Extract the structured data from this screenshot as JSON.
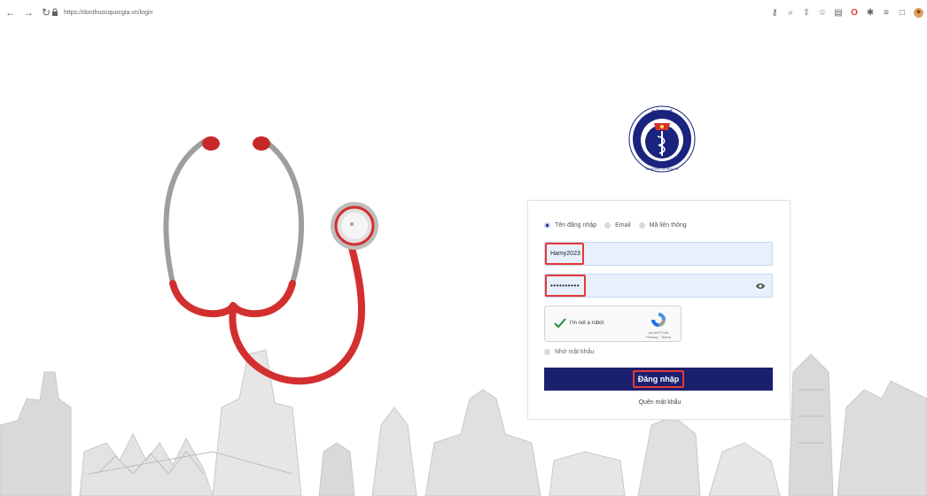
{
  "browser": {
    "url": "https://donthuocquocgia.vn/login"
  },
  "logo": {
    "top_text": "BỘ Y TẾ",
    "bottom_text": "MINISTRY OF HEALTH"
  },
  "login": {
    "radio_options": [
      "Tên đăng nhập",
      "Email",
      "Mã liên thông"
    ],
    "selected_index": 0,
    "username_value": "Hamy2023",
    "password_value": "••••••••••",
    "captcha_label": "I'm not a robot",
    "captcha_brand": "reCAPTCHA",
    "captcha_links": "Privacy - Terms",
    "remember_label": "Nhớ mật khẩu",
    "submit_label": "Đăng nhập",
    "forgot_label": "Quên mật khẩu"
  },
  "colors": {
    "primary_button": "#1a1f6e",
    "highlight_box": "#e53935",
    "input_bg": "#e8f0fe"
  }
}
